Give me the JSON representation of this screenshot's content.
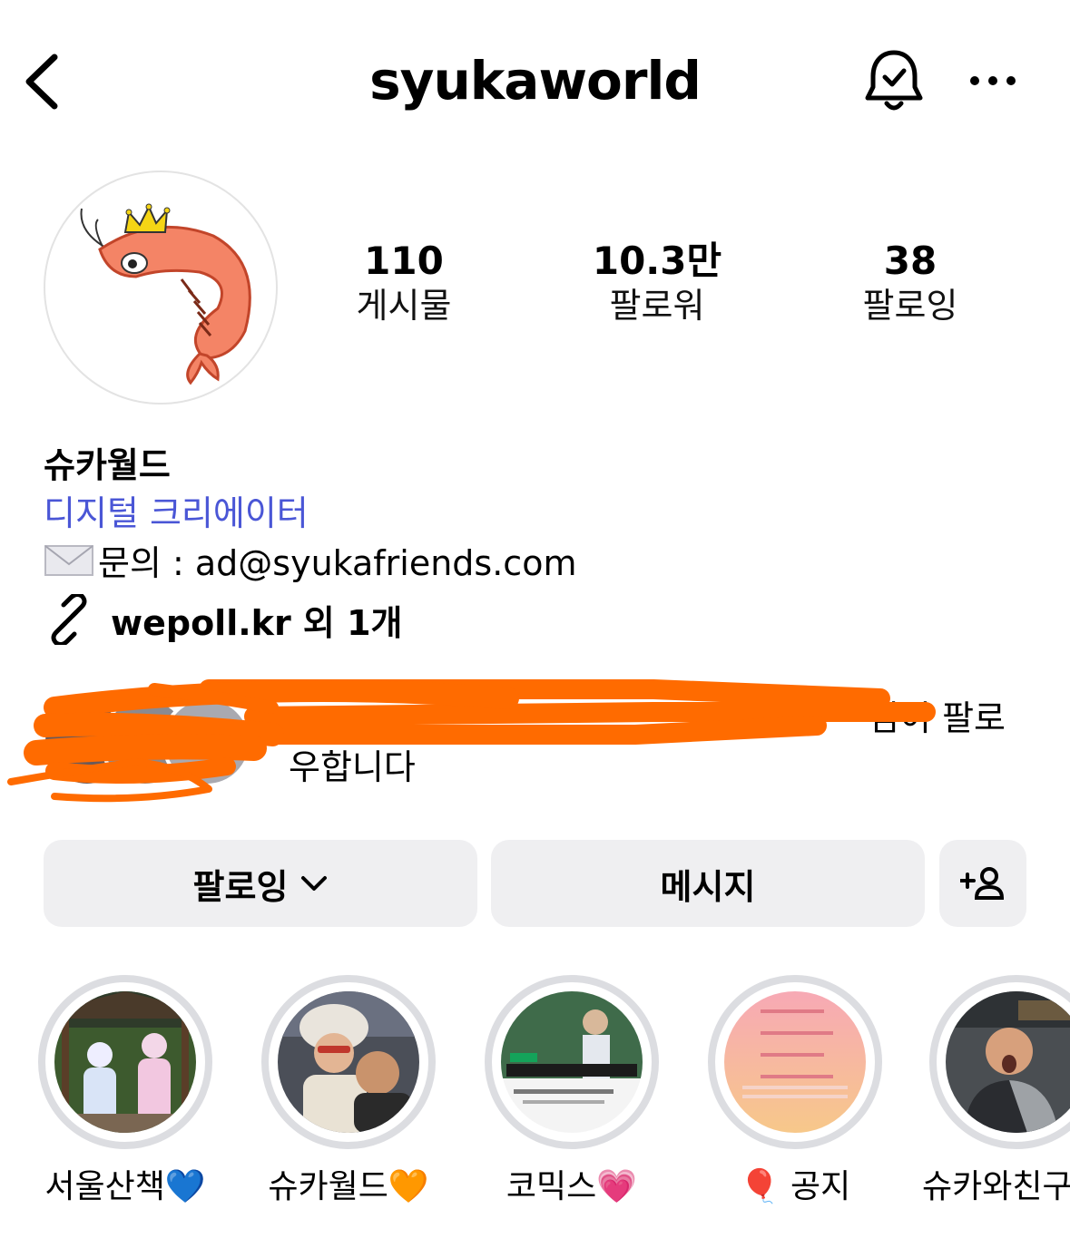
{
  "header": {
    "username": "syukaworld"
  },
  "profile": {
    "stats": [
      {
        "value": "110",
        "label": "게시물"
      },
      {
        "value": "10.3만",
        "label": "팔로워"
      },
      {
        "value": "38",
        "label": "팔로잉"
      }
    ]
  },
  "bio": {
    "name": "슈카월드",
    "category": "디지털 크리에이터",
    "contact": "문의 : ad@syukafriends.com",
    "link": "wepoll.kr 외 1개"
  },
  "followed_by": {
    "text_line1": "님이 팔로",
    "text_line2": "우합니다"
  },
  "actions": {
    "follow_label": "팔로잉",
    "message_label": "메시지"
  },
  "highlights": [
    {
      "label": "서울산책",
      "emoji": "💙"
    },
    {
      "label": "슈카월드",
      "emoji": "🧡"
    },
    {
      "label": "코믹스",
      "emoji": "💗"
    },
    {
      "label": "공지",
      "emoji": "🎈"
    },
    {
      "label": "슈카와친구들",
      "emoji": ""
    }
  ],
  "colors": {
    "category_link": "#4a56d6",
    "button_bg": "#efeff1",
    "highlight_ring": "#dcdde1",
    "redaction": "#ff6b00"
  }
}
